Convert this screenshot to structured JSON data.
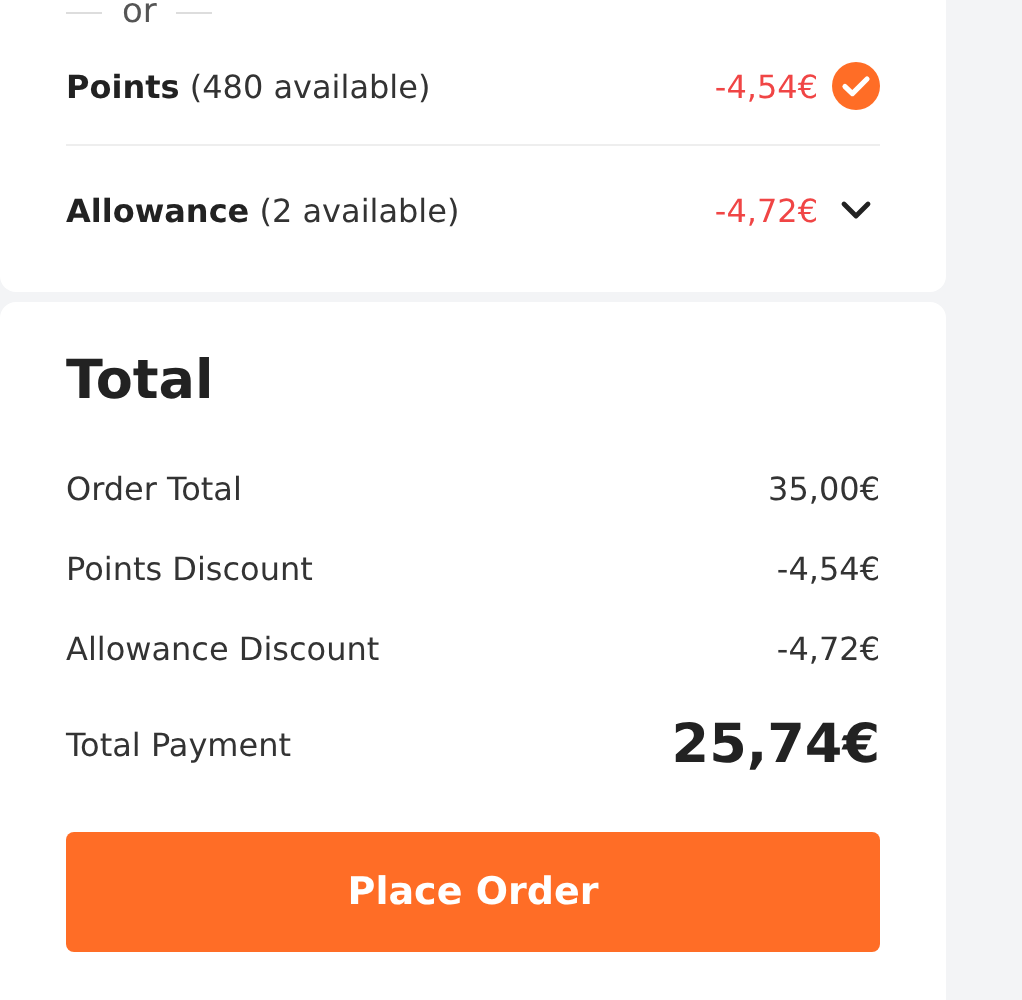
{
  "separator": "or",
  "discounts": [
    {
      "kind": "check",
      "name": "Points",
      "detail": "(480 available)",
      "amount": "-4,54€",
      "checked": true
    },
    {
      "kind": "dropdown",
      "name": "Allowance",
      "detail": "(2 available)",
      "amount": "-4,72€",
      "expanded": false
    }
  ],
  "total": {
    "title": "Total",
    "rows": [
      {
        "label": "Order Total",
        "value": "35,00€"
      },
      {
        "label": "Points Discount",
        "value": "-4,54€"
      },
      {
        "label": "Allowance Discount",
        "value": "-4,72€"
      }
    ],
    "payment": {
      "label": "Total Payment",
      "value": "25,74€"
    },
    "button": "Place Order"
  }
}
